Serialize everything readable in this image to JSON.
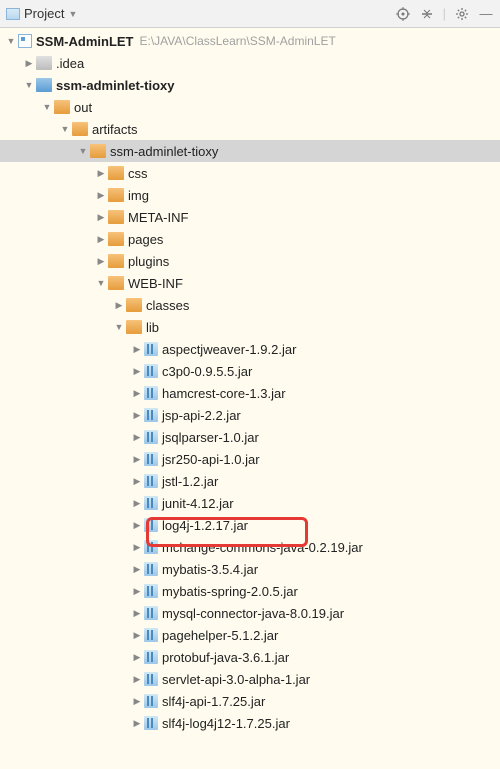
{
  "toolbar": {
    "title": "Project"
  },
  "tree": {
    "root": {
      "name": "SSM-AdminLET",
      "path": "E:\\JAVA\\ClassLearn\\SSM-AdminLET",
      "idea": ".idea",
      "module": "ssm-adminlet-tioxy",
      "out": "out",
      "artifacts": "artifacts",
      "artifact_folder": "ssm-adminlet-tioxy",
      "folders": {
        "css": "css",
        "img": "img",
        "metainf": "META-INF",
        "pages": "pages",
        "plugins": "plugins",
        "webinf": "WEB-INF",
        "classes": "classes",
        "lib": "lib"
      },
      "jars": [
        "aspectjweaver-1.9.2.jar",
        "c3p0-0.9.5.5.jar",
        "hamcrest-core-1.3.jar",
        "jsp-api-2.2.jar",
        "jsqlparser-1.0.jar",
        "jsr250-api-1.0.jar",
        "jstl-1.2.jar",
        "junit-4.12.jar",
        "log4j-1.2.17.jar",
        "mchange-commons-java-0.2.19.jar",
        "mybatis-3.5.4.jar",
        "mybatis-spring-2.0.5.jar",
        "mysql-connector-java-8.0.19.jar",
        "pagehelper-5.1.2.jar",
        "protobuf-java-3.6.1.jar",
        "servlet-api-3.0-alpha-1.jar",
        "slf4j-api-1.7.25.jar",
        "slf4j-log4j12-1.7.25.jar"
      ]
    }
  }
}
